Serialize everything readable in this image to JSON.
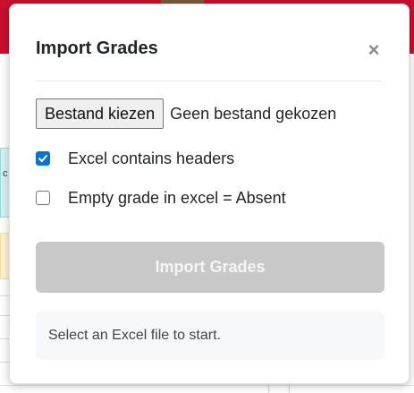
{
  "modal": {
    "title": "Import Grades",
    "close_glyph": "×",
    "file_input": {
      "button_label": "Bestand kiezen",
      "status_text": "Geen bestand gekozen"
    },
    "options": [
      {
        "label": "Excel contains headers",
        "checked": true
      },
      {
        "label": "Empty grade in excel = Absent",
        "checked": false
      }
    ],
    "import_button_label": "Import Grades",
    "info_text": "Select an Excel file to start."
  },
  "background": {
    "partial_cell_text": "c"
  },
  "colors": {
    "topbar": "#c8102e",
    "checkbox_accent": "#0b72d1",
    "disabled_button": "#c8c8c8"
  },
  "icons": {
    "close": "close-icon",
    "check": "check-icon"
  }
}
